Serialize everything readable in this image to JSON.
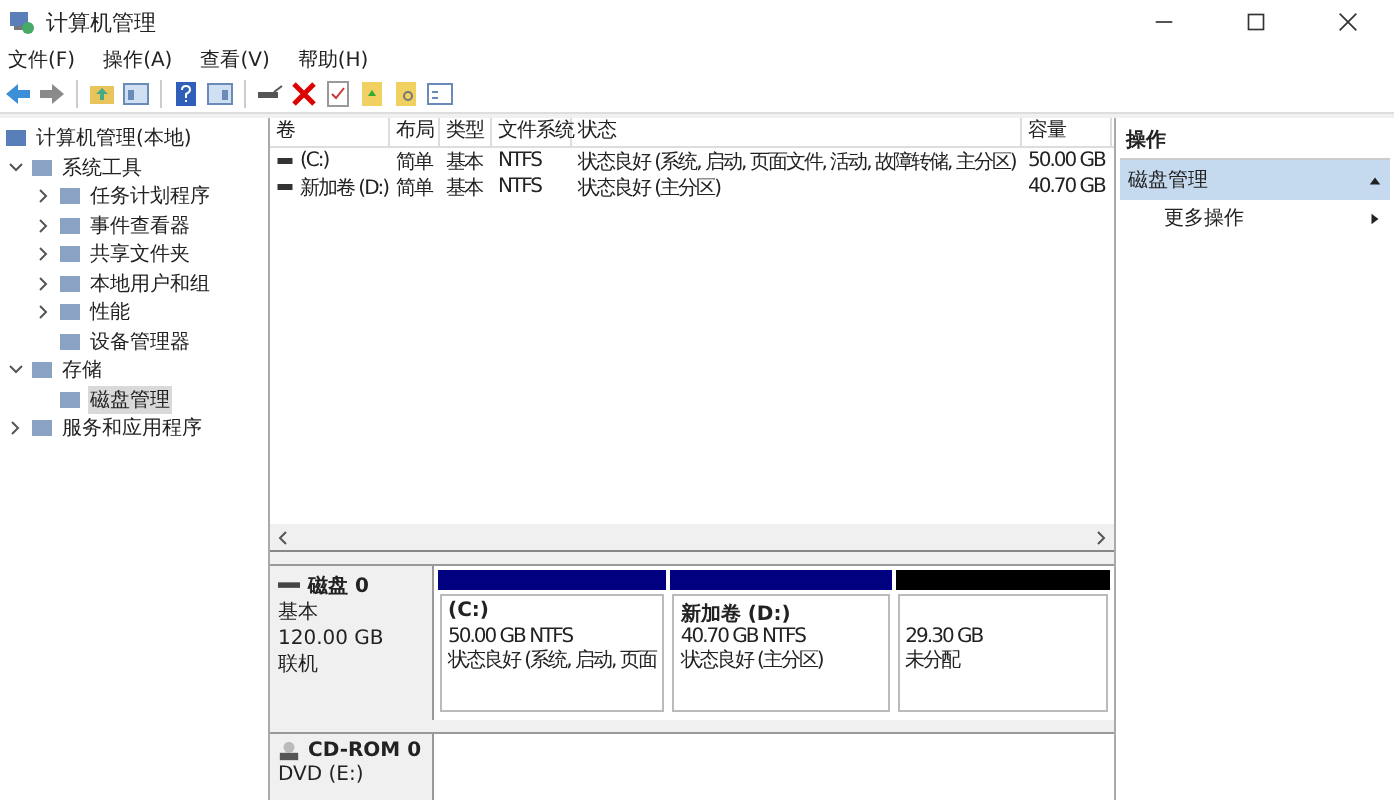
{
  "window": {
    "title": "计算机管理"
  },
  "menu": [
    "文件(F)",
    "操作(A)",
    "查看(V)",
    "帮助(H)"
  ],
  "tree": [
    {
      "label": "计算机管理(本地)",
      "selected": false,
      "children": [
        {
          "label": "系统工具",
          "expanded": true,
          "selected": false,
          "children": [
            {
              "label": "任务计划程序",
              "expanded": false,
              "selected": false
            },
            {
              "label": "事件查看器",
              "expanded": false,
              "selected": false
            },
            {
              "label": "共享文件夹",
              "expanded": false,
              "selected": false
            },
            {
              "label": "本地用户和组",
              "expanded": false,
              "selected": false
            },
            {
              "label": "性能",
              "expanded": false,
              "selected": false
            },
            {
              "label": "设备管理器",
              "selected": false
            }
          ]
        },
        {
          "label": "存储",
          "expanded": true,
          "selected": false,
          "children": [
            {
              "label": "磁盘管理",
              "selected": true
            }
          ]
        },
        {
          "label": "服务和应用程序",
          "expanded": false,
          "selected": false
        }
      ]
    }
  ],
  "table": {
    "columns": [
      "卷",
      "布局",
      "类型",
      "文件系统",
      "状态",
      "容量"
    ],
    "rows": [
      [
        "(C:)",
        "简单",
        "基本",
        "NTFS",
        "状态良好 (系统, 启动, 页面文件, 活动, 故障转储, 主分区)",
        "50.00 GB"
      ],
      [
        "新加卷 (D:)",
        "简单",
        "基本",
        "NTFS",
        "状态良好 (主分区)",
        "40.70 GB"
      ]
    ]
  },
  "disks": [
    {
      "kind": "disk",
      "name": "磁盘 0",
      "lines": [
        "基本",
        "120.00 GB",
        "联机"
      ],
      "partitions": [
        {
          "title": "(C:)",
          "lines": [
            "50.00 GB NTFS",
            "状态良好 (系统, 启动, 页面"
          ],
          "color": "#000080"
        },
        {
          "title": "新加卷  (D:)",
          "lines": [
            "40.70 GB NTFS",
            "状态良好 (主分区)"
          ],
          "color": "#000080"
        },
        {
          "lines": [
            "29.30 GB",
            "未分配"
          ],
          "color": "#000000"
        }
      ]
    },
    {
      "kind": "cdrom",
      "name": "CD-ROM 0",
      "lines": [
        "DVD (E:)"
      ]
    }
  ],
  "actions": {
    "title": "操作",
    "section": "磁盘管理",
    "items": [
      "更多操作"
    ]
  }
}
